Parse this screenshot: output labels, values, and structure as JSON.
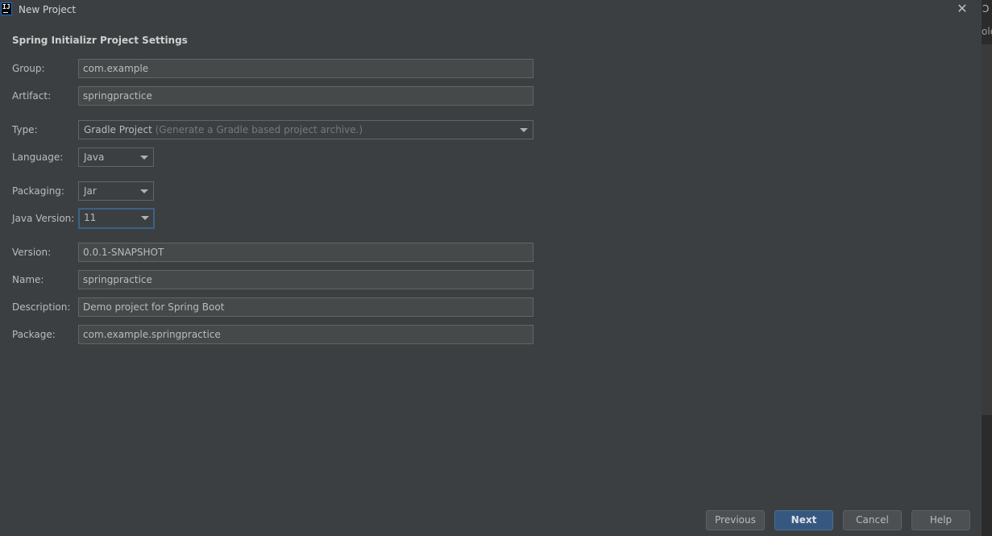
{
  "window": {
    "title": "New Project",
    "icon_text": "IJ",
    "close_glyph": "✕"
  },
  "right_strip": {
    "glyph": "Ↄ",
    "text": "ole"
  },
  "section_title": "Spring Initializr Project Settings",
  "form": {
    "group": {
      "label": "Group:",
      "value": "com.example"
    },
    "artifact": {
      "label": "Artifact:",
      "value": "springpractice"
    },
    "type": {
      "label": "Type:",
      "value": "Gradle Project",
      "hint": "(Generate a Gradle based project archive.)"
    },
    "language": {
      "label": "Language:",
      "value": "Java"
    },
    "packaging": {
      "label": "Packaging:",
      "value": "Jar"
    },
    "java_version": {
      "label": "Java Version:",
      "value": "11"
    },
    "version": {
      "label": "Version:",
      "value": "0.0.1-SNAPSHOT"
    },
    "name": {
      "label": "Name:",
      "value": "springpractice"
    },
    "description": {
      "label": "Description:",
      "value": "Demo project for Spring Boot"
    },
    "package": {
      "label": "Package:",
      "value": "com.example.springpractice"
    }
  },
  "footer": {
    "previous": "Previous",
    "next": "Next",
    "cancel": "Cancel",
    "help": "Help"
  },
  "colors": {
    "background": "#3c3f41",
    "field_background": "#45494a",
    "primary_button": "#365880",
    "focus_border": "#3d6185"
  }
}
